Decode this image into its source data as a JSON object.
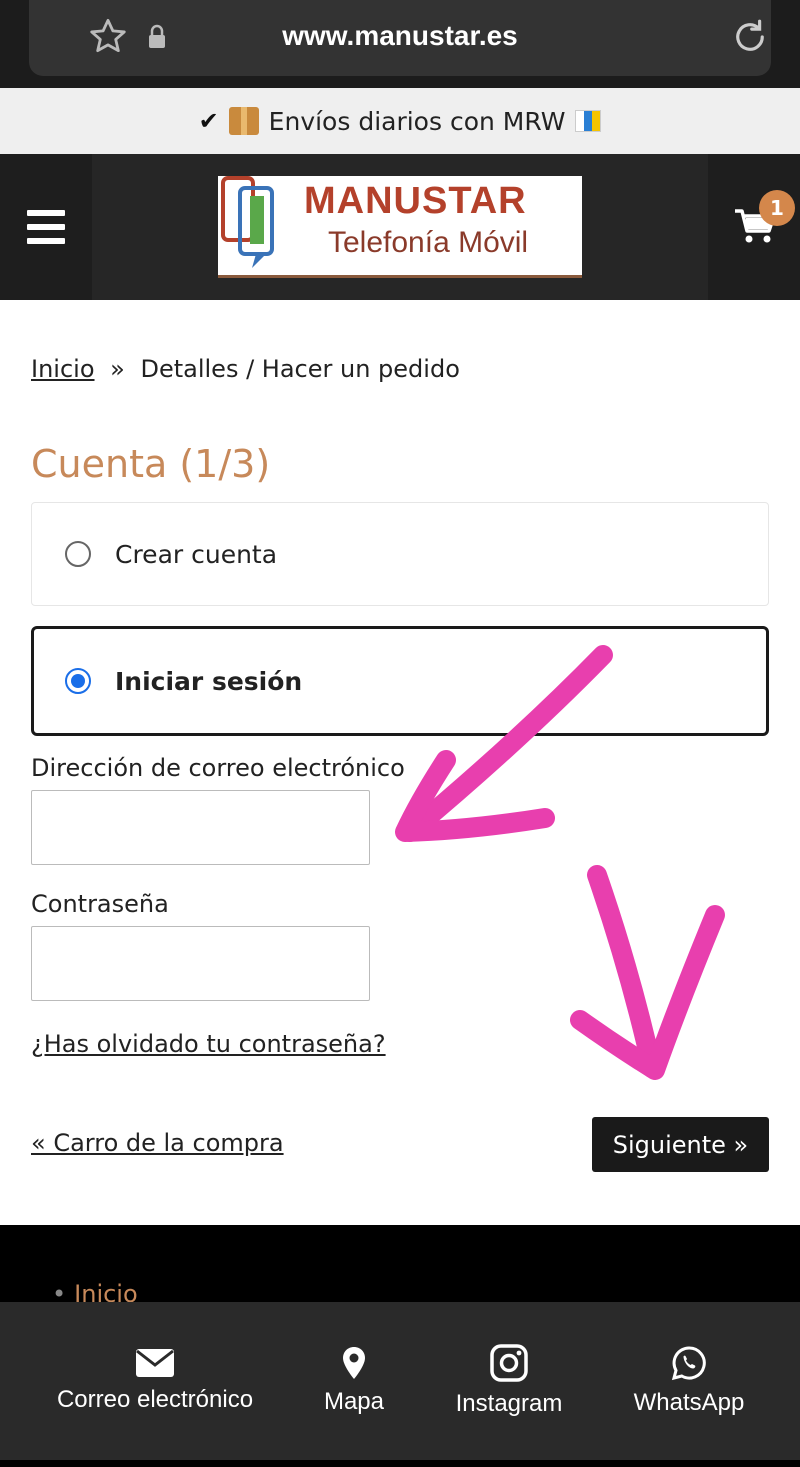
{
  "browser": {
    "url": "www.manustar.es",
    "icons": [
      "star-icon",
      "lock-icon",
      "reload-icon"
    ]
  },
  "promo": {
    "text": "Envíos diarios con MRW"
  },
  "header": {
    "logo_title": "MANUSTAR",
    "logo_subtitle": "Telefonía Móvil",
    "cart_count": "1"
  },
  "breadcrumb": {
    "home": "Inicio",
    "separator": "»",
    "current": "Detalles / Hacer un pedido"
  },
  "account": {
    "title": "Cuenta (1/3)",
    "options": [
      {
        "label": "Crear cuenta",
        "selected": false
      },
      {
        "label": "Iniciar sesión",
        "selected": true
      }
    ],
    "email_label": "Dirección de correo electrónico",
    "email_value": "",
    "password_label": "Contraseña",
    "password_value": "",
    "forgot_link": "¿Has olvidado tu contraseña?",
    "back_link": "« Carro de la compra",
    "next_button": "Siguiente »"
  },
  "footer": {
    "link": "Inicio"
  },
  "bottom_nav": [
    {
      "label": "Correo electrónico",
      "icon": "envelope-icon"
    },
    {
      "label": "Mapa",
      "icon": "map-pin-icon"
    },
    {
      "label": "Instagram",
      "icon": "instagram-icon"
    },
    {
      "label": "WhatsApp",
      "icon": "whatsapp-icon"
    }
  ],
  "colors": {
    "accent": "#c7895a",
    "annotation": "#e83fae",
    "radio": "#1a6ee8"
  }
}
